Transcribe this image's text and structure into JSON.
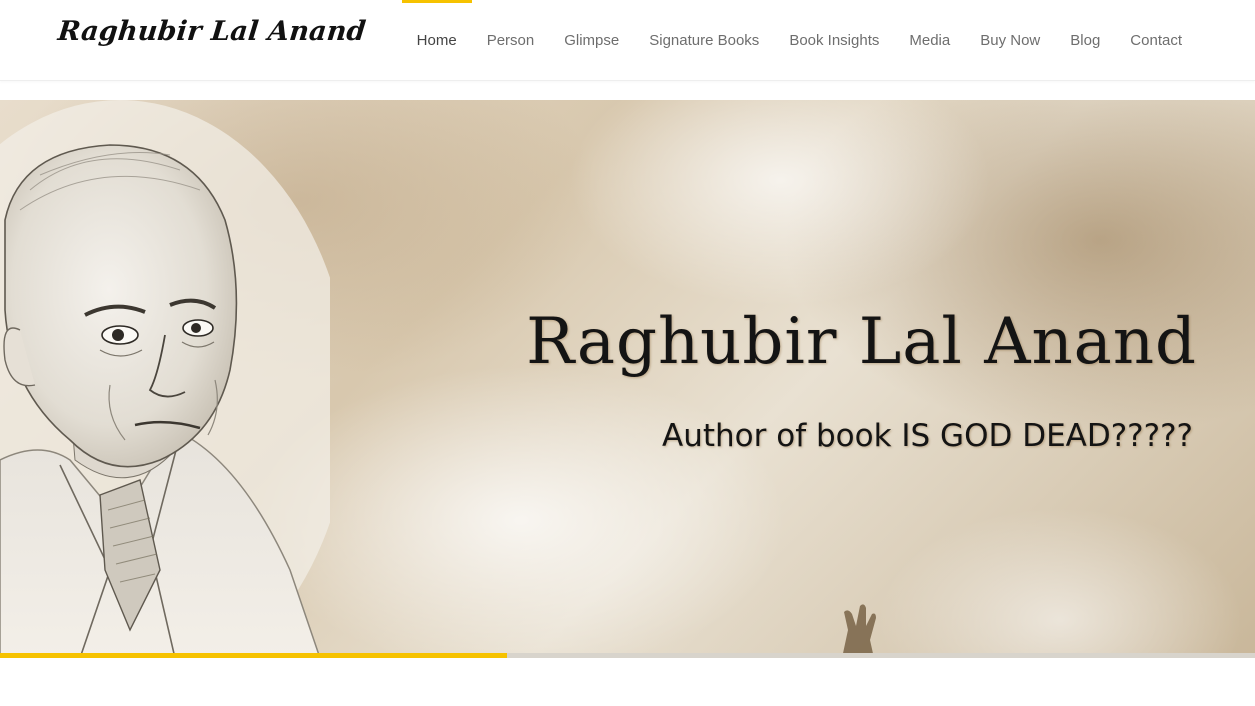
{
  "brand": {
    "logo_text": "Raghubir Lal Anand"
  },
  "nav": {
    "items": [
      {
        "label": "Home",
        "active": true
      },
      {
        "label": "Person"
      },
      {
        "label": "Glimpse"
      },
      {
        "label": "Signature Books"
      },
      {
        "label": "Book Insights"
      },
      {
        "label": "Media"
      },
      {
        "label": "Buy Now"
      },
      {
        "label": "Blog"
      },
      {
        "label": "Contact"
      }
    ],
    "active_indicator_color": "#f6c200"
  },
  "hero": {
    "title": "Raghubir Lal Anand",
    "subtitle": "Author of book IS GOD DEAD?????",
    "progress": 0.404,
    "progress_color": "#f6c200"
  }
}
